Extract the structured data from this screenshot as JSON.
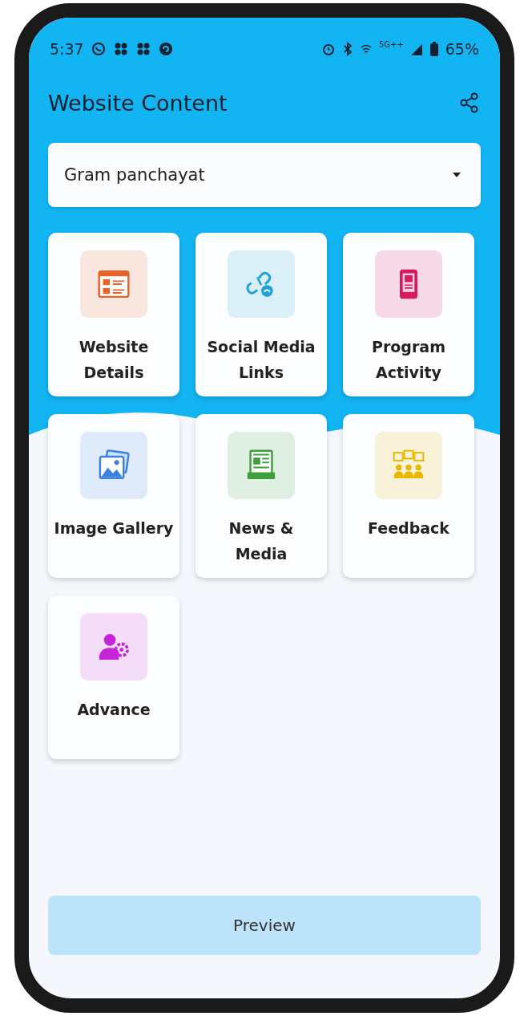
{
  "status_bar": {
    "time": "5:37",
    "network": "5G++",
    "battery": "65%"
  },
  "app_bar": {
    "title": "Website Content"
  },
  "dropdown": {
    "value": "Gram panchayat"
  },
  "tiles": [
    {
      "label": "Website Details",
      "color": "#e8622a"
    },
    {
      "label": "Social Media Links",
      "color": "#1fa3d6"
    },
    {
      "label": "Program Activity",
      "color": "#d81b60"
    },
    {
      "label": "Image Gallery",
      "color": "#3b82e0"
    },
    {
      "label": "News & Media",
      "color": "#3f9e3a"
    },
    {
      "label": "Feedback",
      "color": "#e6b800"
    },
    {
      "label": "Advance",
      "color": "#c425d6"
    }
  ],
  "preview_button": {
    "label": "Preview"
  }
}
